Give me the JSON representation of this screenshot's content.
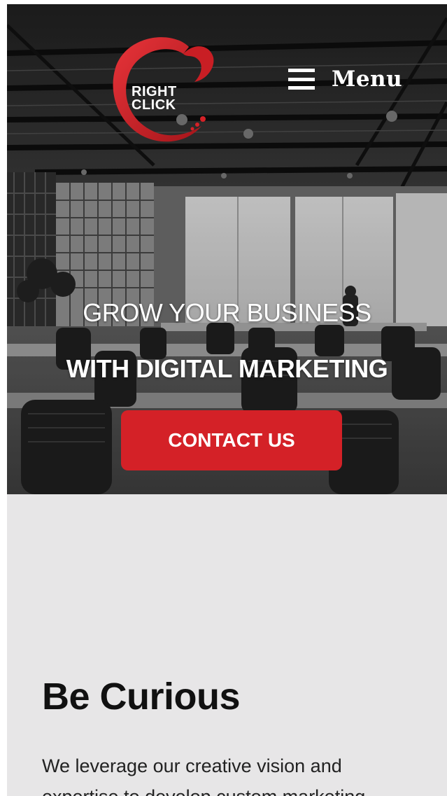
{
  "brand": {
    "logo_line1": "RIGHT",
    "logo_line2": "CLICK",
    "accent_color": "#d42127"
  },
  "nav": {
    "menu_icon": "hamburger-menu-icon",
    "menu_label": "Menu"
  },
  "hero": {
    "headline_line1": "GROW YOUR BUSINESS",
    "headline_line2": "WITH DIGITAL MARKETING",
    "cta_label": "CONTACT US",
    "background": "grayscale office interior photo"
  },
  "section": {
    "title": "Be Curious",
    "text": "We leverage our creative vision and expertise to develop custom marketing"
  }
}
